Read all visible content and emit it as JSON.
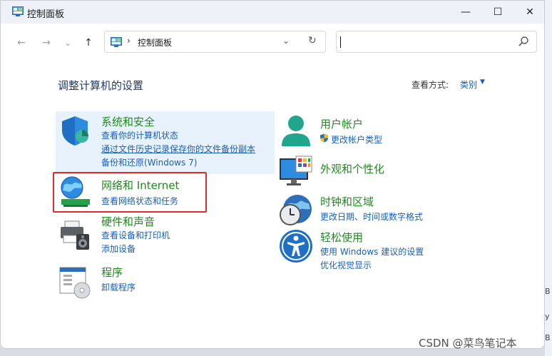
{
  "window": {
    "title": "控制面板",
    "minimize_glyph": "—",
    "maximize_glyph": "☐",
    "close_glyph": "✕"
  },
  "nav": {
    "back_glyph": "←",
    "forward_glyph": "→",
    "recent_glyph": "⌄",
    "up_glyph": "↑"
  },
  "address": {
    "separator": "›",
    "crumb": "控制面板",
    "dropdown_glyph": "⌄",
    "refresh_glyph": "↻"
  },
  "search": {
    "value": "",
    "placeholder": ""
  },
  "main": {
    "heading": "调整计算机的设置",
    "view_by_label": "查看方式:",
    "view_by_value": "类别",
    "view_by_arrow": "▼"
  },
  "left_categories": [
    {
      "title": "系统和安全",
      "icon": "shield-icon",
      "links": [
        "查看你的计算机状态",
        "通过文件历史记录保存你的文件备份副本",
        "备份和还原(Windows 7)"
      ]
    },
    {
      "title": "网络和 Internet",
      "icon": "network-globe-icon",
      "links": [
        "查看网络状态和任务"
      ]
    },
    {
      "title": "硬件和声音",
      "icon": "printer-speaker-icon",
      "links": [
        "查看设备和打印机",
        "添加设备"
      ]
    },
    {
      "title": "程序",
      "icon": "programs-disc-icon",
      "links": [
        "卸载程序"
      ]
    }
  ],
  "right_categories": [
    {
      "title": "用户帐户",
      "icon": "user-icon",
      "links": [
        "更改帐户类型"
      ]
    },
    {
      "title": "外观和个性化",
      "icon": "monitor-palette-icon",
      "links": []
    },
    {
      "title": "时钟和区域",
      "icon": "clock-globe-icon",
      "links": [
        "更改日期、时间或数字格式"
      ]
    },
    {
      "title": "轻松使用",
      "icon": "accessibility-icon",
      "links": [
        "使用 Windows 建议的设置",
        "优化视觉显示"
      ]
    }
  ],
  "right_edge": {
    "fragment_1": "B",
    "fragment_2": "y",
    "fragment_3": "B"
  },
  "watermark": "CSDN @菜鸟笔记本",
  "colors": {
    "category_title": "#1f8a1f",
    "link": "#1a5fb4",
    "highlight_bg": "#e8f2fc",
    "annotation_red": "#e32b2b"
  }
}
